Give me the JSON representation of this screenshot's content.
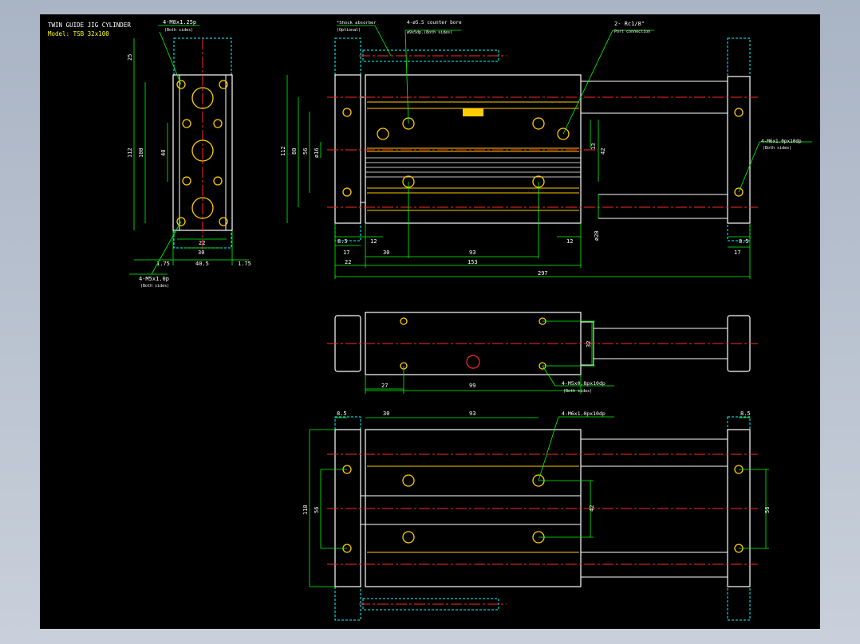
{
  "title_block": {
    "title": "TWIN GUIDE JIG CYLINDER",
    "model": "Model: TSB 32x100"
  },
  "colors": {
    "background": "#000000",
    "outline": "#ffffff",
    "dimension": "#00ff00",
    "center_line": "#ff2a2a",
    "hidden_line": "#00ffff",
    "hole": "#ffcc00",
    "annotation": "#ffffff"
  },
  "side_view_left": {
    "callout_top": "4-M8x1.25p",
    "callout_top_note": "(Both sides)",
    "callout_bottom": "4-M5x1.0p",
    "callout_bottom_note": "(Both sides)",
    "dims": {
      "d25": "25",
      "d112": "112",
      "d100": "100",
      "d40": "40",
      "d22": "22",
      "d30": "30",
      "d175_left": "1.75",
      "d405": "40.5",
      "d175_right": "1.75"
    }
  },
  "front_view": {
    "callout_shock": "*Shock absorber",
    "callout_shock_note": "(Optional)",
    "callout_cbore": "4-ø5.5 counter bore",
    "callout_cbore_note": "ø9x5dp.(Both sides)",
    "callout_port": "2- Rc1/8\"",
    "callout_port_note": "Port connection",
    "callout_side": "4-M6x1.0px10dp",
    "callout_side_note": "(Both sides)",
    "dims": {
      "d112": "112",
      "d80": "80",
      "d56": "56",
      "d16": "ø16",
      "d13": "13",
      "d42": "42",
      "d20": "ø20",
      "d85_left": "8.5",
      "d12_left": "12",
      "d17_left": "17",
      "d30": "30",
      "d93": "93",
      "d12_right": "12",
      "d22": "22",
      "d153": "153",
      "d297": "297",
      "d85_right": "8.5",
      "d17_right": "17"
    }
  },
  "top_view": {
    "callout": "4-M5x0.8px10dp",
    "callout_note": "(Both sides)",
    "dims": {
      "d32": "32",
      "d27": "27",
      "d99": "99"
    }
  },
  "bottom_view": {
    "callout": "4-M6x1.0px10dp",
    "dims": {
      "d85_left": "8.5",
      "d30": "30",
      "d93": "93",
      "d85_right": "8.5",
      "d110": "110",
      "d56_left": "56",
      "d42": "42",
      "d56_right": "56"
    }
  }
}
